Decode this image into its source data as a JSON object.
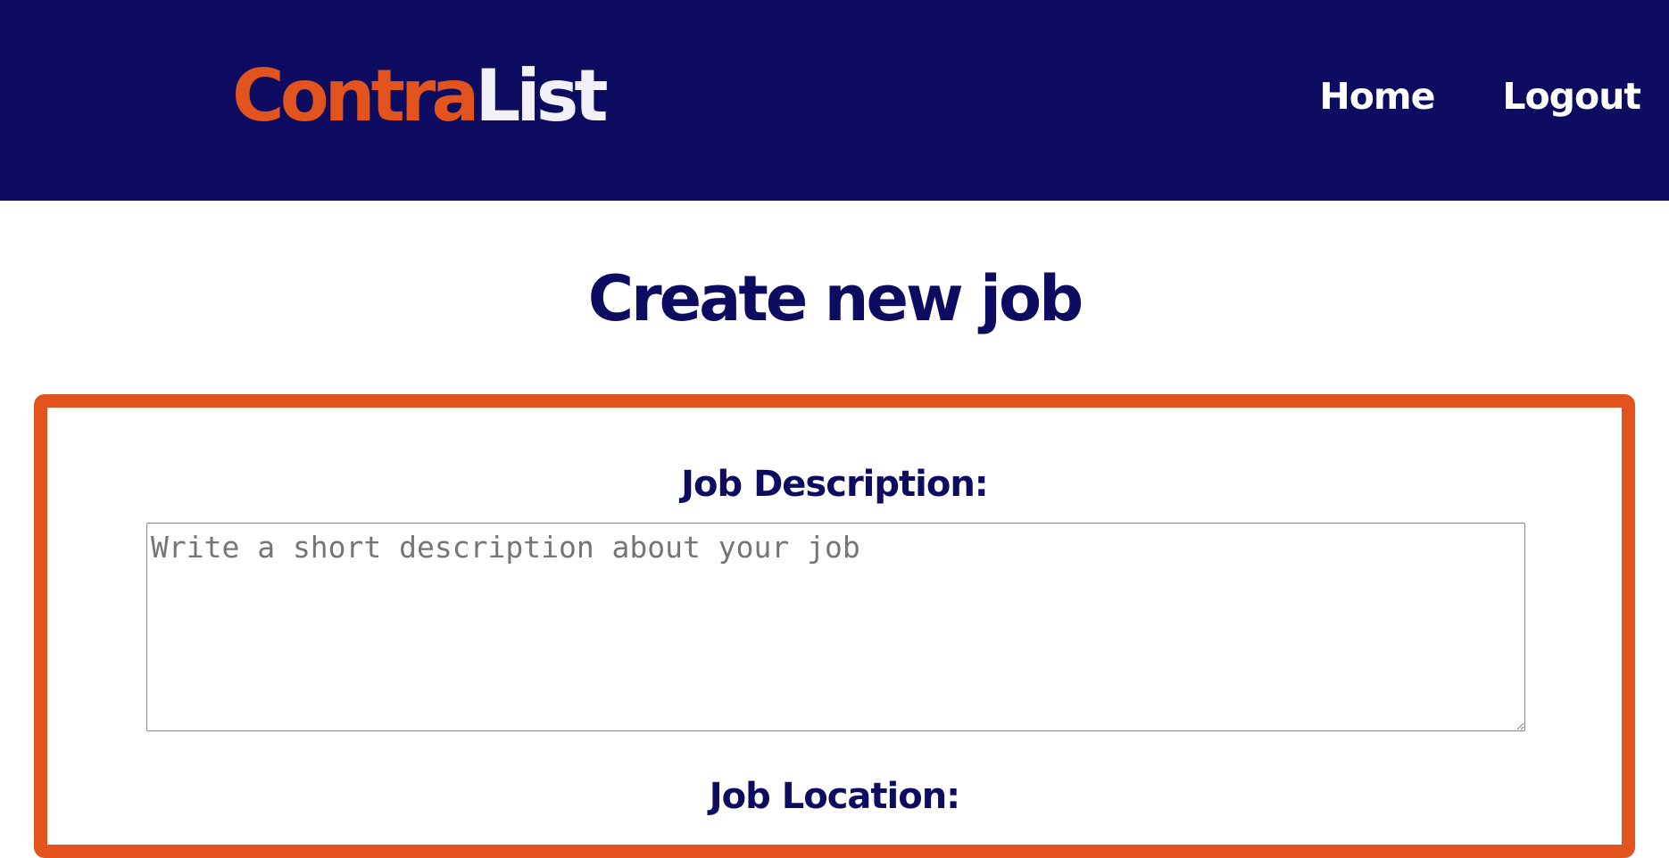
{
  "header": {
    "logo": {
      "part_a": "Contra",
      "part_b": "List"
    },
    "nav": {
      "home": "Home",
      "logout": "Logout"
    }
  },
  "page": {
    "title": "Create new job"
  },
  "form": {
    "description": {
      "label": "Job Description:",
      "value": "",
      "placeholder": "Write a short description about your job"
    },
    "location": {
      "label": "Job Location:"
    }
  },
  "colors": {
    "header_bg": "#0d0c61",
    "accent": "#e3531e",
    "title_text": "#0d0c61",
    "logo_secondary": "#f2f1f7"
  }
}
